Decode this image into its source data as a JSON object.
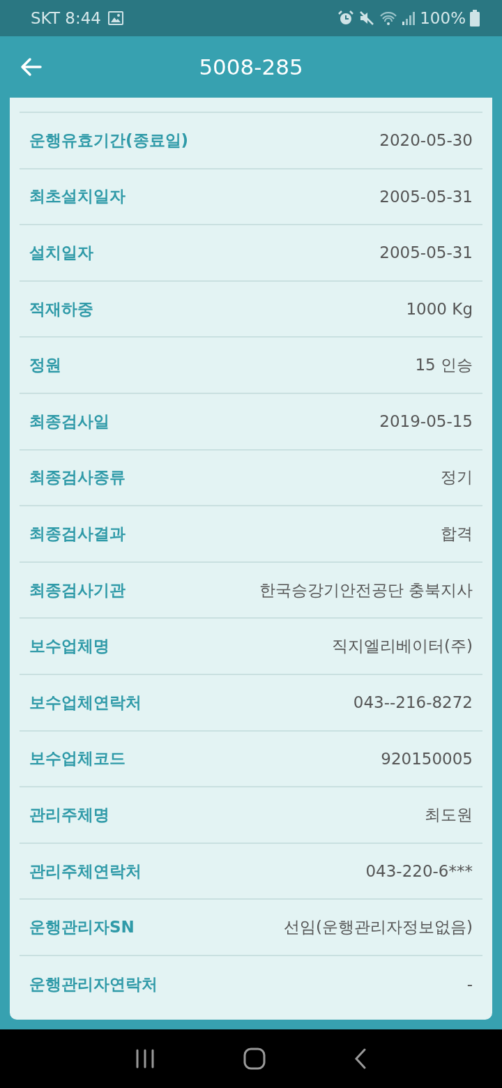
{
  "status_bar": {
    "carrier": "SKT",
    "time": "8:44",
    "battery": "100%"
  },
  "header": {
    "title": "5008-285"
  },
  "details": [
    {
      "label": "운행유효기간(종료일)",
      "value": "2020-05-30"
    },
    {
      "label": "최초설치일자",
      "value": "2005-05-31"
    },
    {
      "label": "설치일자",
      "value": "2005-05-31"
    },
    {
      "label": "적재하중",
      "value": "1000 Kg"
    },
    {
      "label": "정원",
      "value": "15 인승"
    },
    {
      "label": "최종검사일",
      "value": "2019-05-15"
    },
    {
      "label": "최종검사종류",
      "value": "정기"
    },
    {
      "label": "최종검사결과",
      "value": "합격"
    },
    {
      "label": "최종검사기관",
      "value": "한국승강기안전공단 충북지사"
    },
    {
      "label": "보수업체명",
      "value": "직지엘리베이터(주)"
    },
    {
      "label": "보수업체연락처",
      "value": "043--216-8272"
    },
    {
      "label": "보수업체코드",
      "value": "920150005"
    },
    {
      "label": "관리주체명",
      "value": "최도원"
    },
    {
      "label": "관리주체연락처",
      "value": "043-220-6***"
    },
    {
      "label": "운행관리자SN",
      "value": "선임(운행관리자정보없음)"
    },
    {
      "label": "운행관리자연락처",
      "value": "-"
    }
  ]
}
